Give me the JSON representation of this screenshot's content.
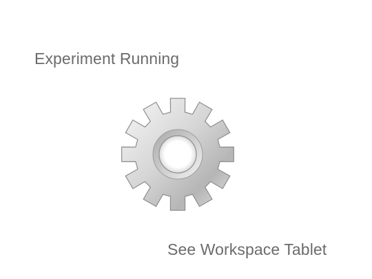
{
  "screen": {
    "status_text": "Experiment Running",
    "hint_text": "See Workspace Tablet",
    "icon": "gear-icon"
  },
  "colors": {
    "background": "#ffffff",
    "text": "#6b6b6b",
    "gear_light": "#f4f4f4",
    "gear_dark": "#9a9a9a",
    "gear_outline": "#8c8c8c"
  }
}
